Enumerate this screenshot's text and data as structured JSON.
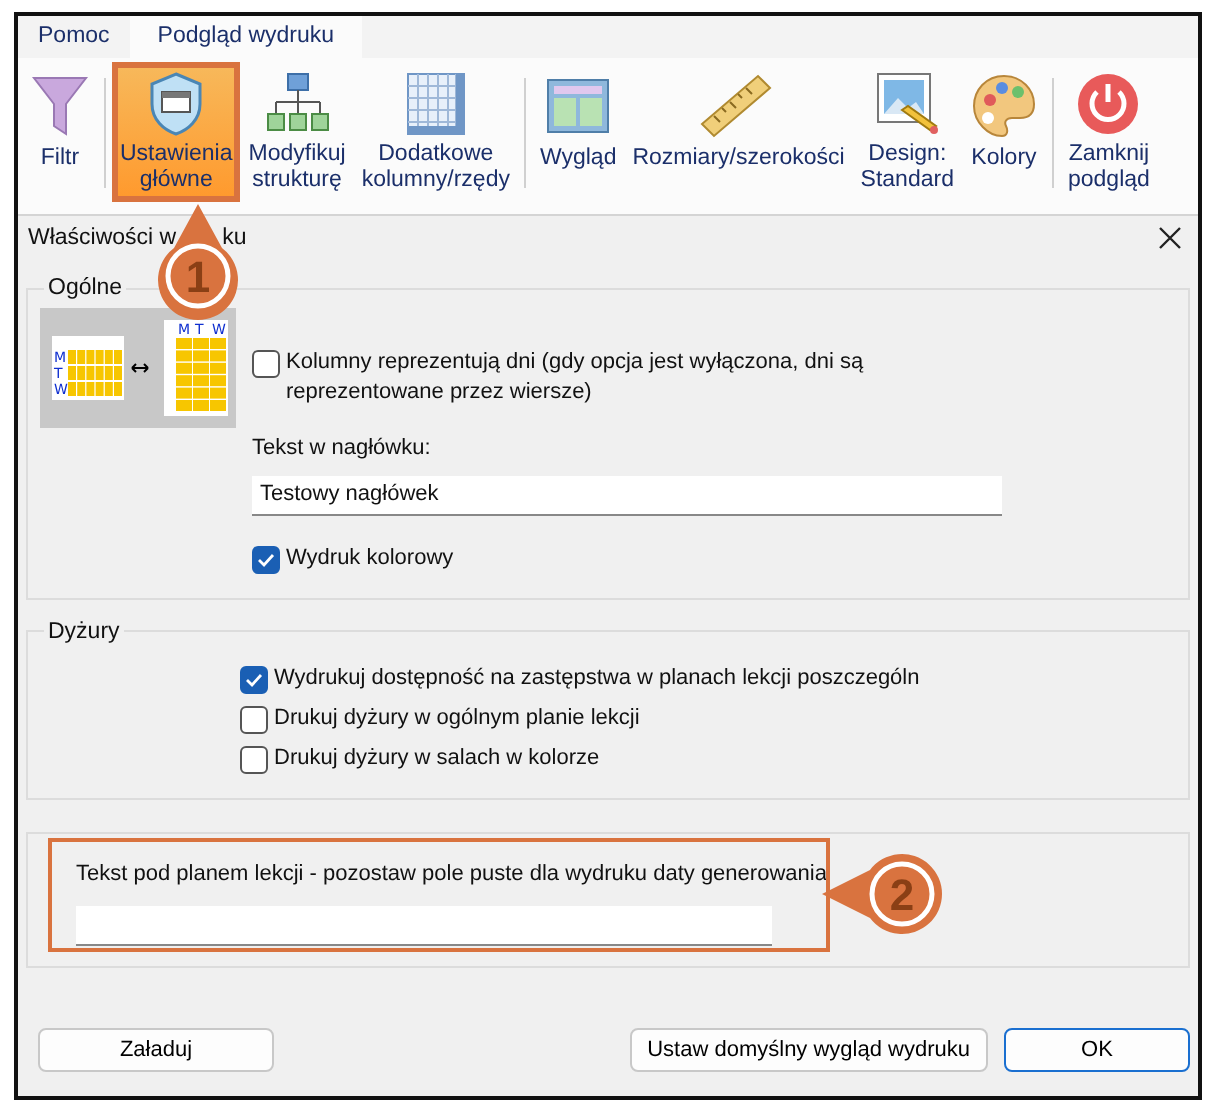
{
  "tabs": [
    {
      "label": "Pomoc",
      "selected": false
    },
    {
      "label": "Podgląd wydruku",
      "selected": true
    }
  ],
  "ribbon": {
    "groups": [
      {
        "items": [
          {
            "kind": "filter",
            "label": "Filtr",
            "selected": false
          }
        ]
      },
      {
        "items": [
          {
            "kind": "shield",
            "label": "Ustawienia\ngłówne",
            "selected": true
          },
          {
            "kind": "hierarchy",
            "label": "Modyfikuj\nstrukturę",
            "selected": false
          },
          {
            "kind": "grid",
            "label": "Dodatkowe\nkolumny/rzędy",
            "selected": false
          }
        ]
      },
      {
        "items": [
          {
            "kind": "layout",
            "label": "Wygląd",
            "selected": false
          },
          {
            "kind": "ruler",
            "label": "Rozmiary/szerokości",
            "selected": false
          },
          {
            "kind": "image",
            "label": "Design:\nStandard",
            "selected": false
          },
          {
            "kind": "palette",
            "label": "Kolory",
            "selected": false
          }
        ]
      },
      {
        "items": [
          {
            "kind": "power",
            "label": "Zamknij\npodgląd",
            "selected": false
          }
        ]
      }
    ]
  },
  "dialog": {
    "title_parts": [
      "Właściwości w",
      "ku"
    ],
    "general": {
      "legend": "Ogólne",
      "illustration": {
        "row_labels": [
          "M",
          "T",
          "W"
        ],
        "column_labels": [
          "M",
          "T",
          "W"
        ]
      },
      "columns_are_days": {
        "label": "Kolumny reprezentują dni (gdy opcja jest wyłączona, dni są reprezentowane przez wiersze)",
        "checked": false
      },
      "header_label": "Tekst w nagłówku:",
      "header_value": "Testowy nagłówek",
      "color_print": {
        "label": "Wydruk kolorowy",
        "checked": true
      }
    },
    "duties": {
      "legend": "Dyżury",
      "options": [
        {
          "label": "Wydrukuj dostępność na zastępstwa w planach lekcji poszczególn",
          "checked": true
        },
        {
          "label": "Drukuj dyżury w ogólnym planie lekcji",
          "checked": false
        },
        {
          "label": "Drukuj dyżury w salach w kolorze",
          "checked": false
        }
      ]
    },
    "footer_text": {
      "label": "Tekst pod planem lekcji - pozostaw pole puste dla wydruku daty generowania"
    },
    "buttons": [
      {
        "label": "Załaduj",
        "kind": "normal"
      },
      {
        "label": "Ustaw domyślny wygląd wydruku",
        "kind": "normal"
      },
      {
        "label": "OK",
        "kind": "default"
      }
    ]
  },
  "callouts": [
    {
      "number": "1"
    },
    {
      "number": "2"
    }
  ]
}
